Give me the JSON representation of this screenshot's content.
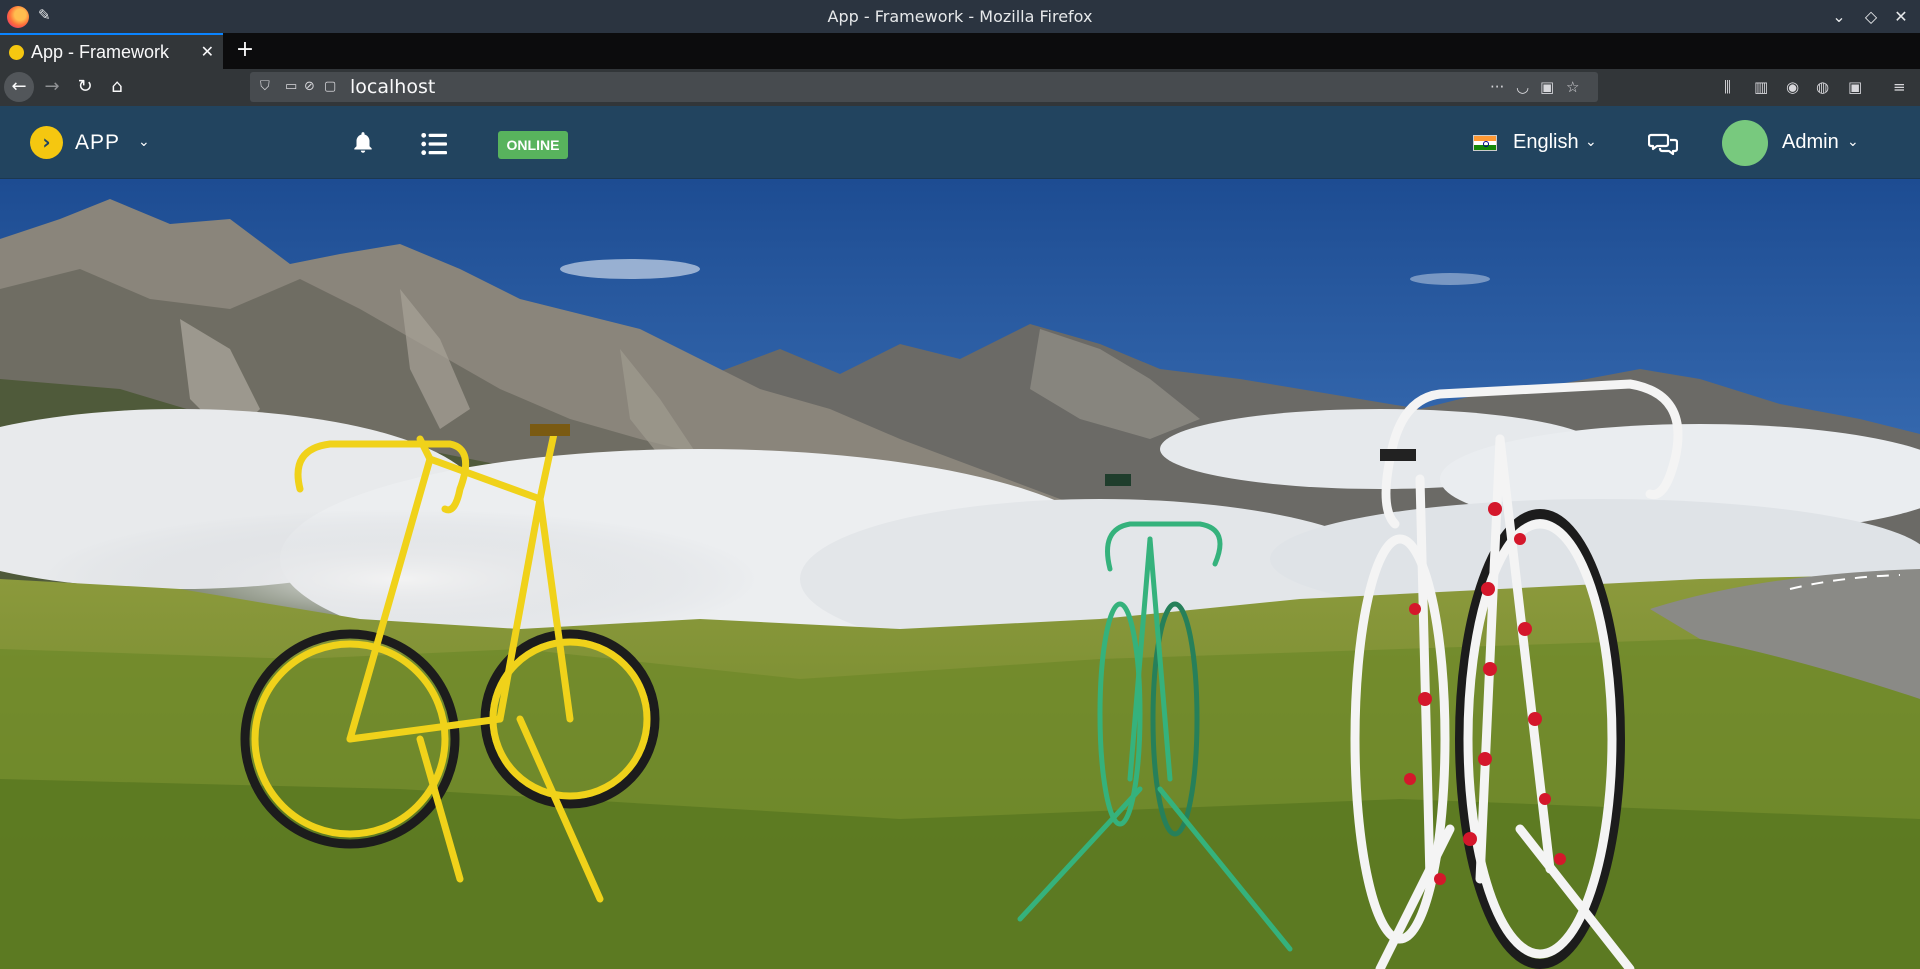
{
  "window": {
    "title": "App - Framework - Mozilla Firefox"
  },
  "browser": {
    "tab_title": "App - Framework",
    "tab_close": "✕",
    "new_tab": "+",
    "url": "localhost",
    "url_more": "···"
  },
  "app": {
    "name": "APP",
    "status": "ONLINE",
    "language": "English",
    "user": "Admin",
    "colors": {
      "header": "#22445f",
      "logo": "#f5c710",
      "online": "#58b35d",
      "avatar": "#78c97e"
    }
  },
  "icons": {
    "window": [
      "firefox-logo-icon",
      "pin-icon",
      "minimize-icon",
      "restore-icon",
      "close-icon"
    ],
    "nav": [
      "back-icon",
      "forward-icon",
      "reload-icon",
      "home-icon"
    ],
    "app": [
      "chevron-right-logo-icon",
      "bell-icon",
      "list-icon",
      "india-flag-icon",
      "chat-icon",
      "chevron-down-icon"
    ]
  }
}
